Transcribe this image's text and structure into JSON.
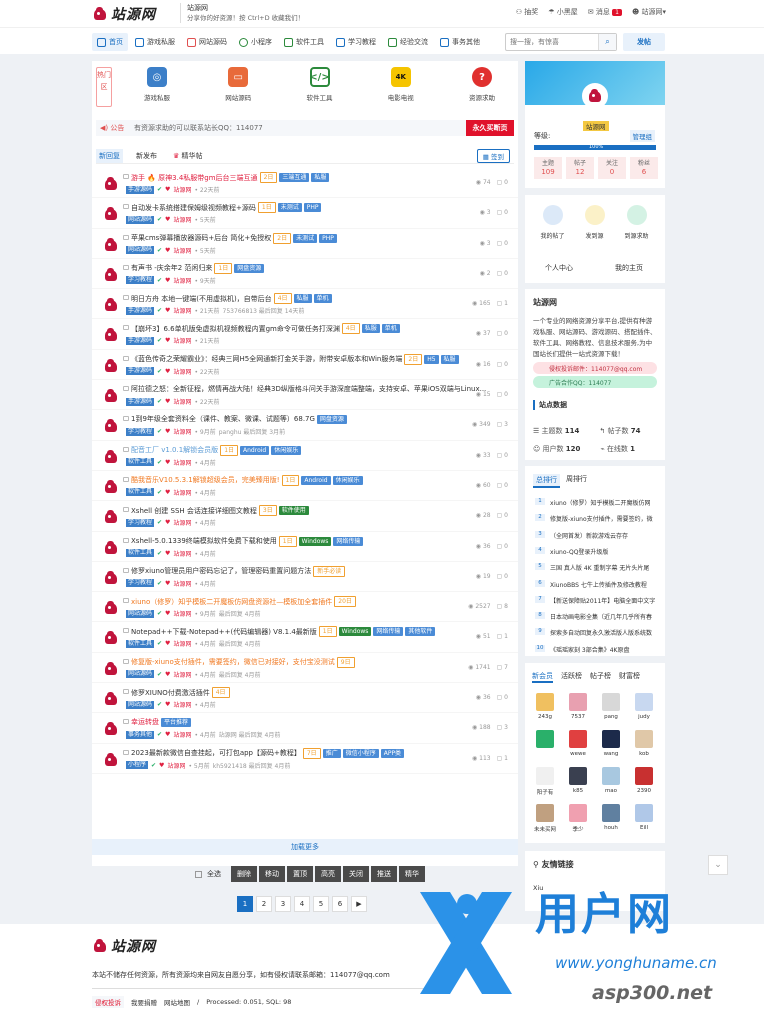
{
  "header": {
    "site_name": "站源网",
    "slogan_title": "站源网",
    "slogan_sub": "分享你的好资源！按 Ctrl+D 收藏我们！",
    "links": [
      "抽奖",
      "小黑屋",
      "消息",
      "站源网"
    ],
    "msg_count": "1"
  },
  "nav": {
    "items": [
      "首页",
      "游戏私服",
      "网站源码",
      "小程序",
      "软件工具",
      "学习教程",
      "经验交流",
      "事务其他"
    ],
    "search_placeholder": "搜一搜，有惊喜",
    "post": "发帖"
  },
  "hot": "热门区",
  "categories": [
    "游戏私服",
    "网站源码",
    "软件工具",
    "电影电视",
    "资源求助"
  ],
  "notice": {
    "label": "公告",
    "text": "有资源求助的可以联系站长QQ：114077",
    "button": "永久买断页"
  },
  "tabs": {
    "new_reply": "新回复",
    "new_post": "新发布",
    "digest": "精华帖",
    "signin": "签到"
  },
  "threads": [
    {
      "title": "游手 🔥 原神3.4私服带gm后台三端互通",
      "tags": [
        {
          "t": "2日",
          "c": "tg-orange"
        },
        {
          "t": "三端互通",
          "c": "tg-blue"
        },
        {
          "t": "私服",
          "c": "tg-blue"
        }
      ],
      "cat": "手游源码",
      "user": "站源网",
      "time": "22天前",
      "views": "74",
      "replies": "0",
      "tred": true
    },
    {
      "title": "自动发卡系统搭建保姆级视频教程+源码",
      "tags": [
        {
          "t": "1日",
          "c": "tg-orange"
        },
        {
          "t": "未测试",
          "c": "tg-blue"
        },
        {
          "t": "PHP",
          "c": "tg-blue"
        }
      ],
      "cat": "网站源码",
      "user": "站源网",
      "time": "5天前",
      "views": "3",
      "replies": "0"
    },
    {
      "title": "苹果cms弹幕播放器源码+后台 简化+免授权",
      "tags": [
        {
          "t": "2日",
          "c": "tg-orange"
        },
        {
          "t": "未测试",
          "c": "tg-blue"
        },
        {
          "t": "PHP",
          "c": "tg-blue"
        }
      ],
      "cat": "网站源码",
      "user": "站源网",
      "time": "5天前",
      "views": "3",
      "replies": "0"
    },
    {
      "title": "有声书 -庆余年2 范闲归来",
      "tags": [
        {
          "t": "1日",
          "c": "tg-orange"
        },
        {
          "t": "网盘资源",
          "c": "tg-blue"
        }
      ],
      "cat": "学习教程",
      "user": "站源网",
      "time": "9天前",
      "views": "2",
      "replies": "0"
    },
    {
      "title": "明日方舟 本地一键端(不用虚拟机)，自带后台",
      "tags": [
        {
          "t": "4日",
          "c": "tg-orange"
        },
        {
          "t": "私服",
          "c": "tg-blue"
        },
        {
          "t": "单机",
          "c": "tg-blue"
        }
      ],
      "cat": "手游源码",
      "user": "站源网",
      "time": "21天前",
      "extra": "753766813 最后回复 14天前",
      "views": "165",
      "replies": "1"
    },
    {
      "title": "【崩坏3】6.6单机版免虚拟机视频教程内置gm命令可做任务打深渊",
      "tags": [
        {
          "t": "4日",
          "c": "tg-orange"
        },
        {
          "t": "私服",
          "c": "tg-blue"
        },
        {
          "t": "单机",
          "c": "tg-blue"
        }
      ],
      "cat": "手游源码",
      "user": "站源网",
      "time": "21天前",
      "views": "37",
      "replies": "0"
    },
    {
      "title": "《蓝色传奇之荣耀霸业》：经典三网H5全网通新打金关手游，附带安卓版本和Win服务端",
      "tags": [
        {
          "t": "2日",
          "c": "tg-orange"
        },
        {
          "t": "H5",
          "c": "tg-blue"
        },
        {
          "t": "私服",
          "c": "tg-blue"
        }
      ],
      "cat": "手游源码",
      "user": "站源网",
      "time": "22天前",
      "views": "16",
      "replies": "0"
    },
    {
      "title": "阿拉德之怒：全新征程，燃情再战大陆！经典3D纵版格斗问关手游深度端整端，支持安卓、苹果iOS双端与Linux...",
      "tags": [],
      "cat": "手游源码",
      "user": "站源网",
      "time": "22天前",
      "views": "15",
      "replies": "0"
    },
    {
      "title": "1到9年级全套资料全（课件、教案、微课、试题等）68.7G",
      "tags": [
        {
          "t": "网盘资源",
          "c": "tg-blue"
        }
      ],
      "cat": "学习教程",
      "user": "站源网",
      "time": "9月前",
      "extra": "panghu 最后回复 3月前",
      "views": "349",
      "replies": "3"
    },
    {
      "title": "配音工厂 v1.0.1解锁会员版",
      "tags": [
        {
          "t": "1日",
          "c": "tg-orange"
        },
        {
          "t": "Android",
          "c": "tg-blue"
        },
        {
          "t": "休闲娱乐",
          "c": "tg-blue"
        }
      ],
      "cat": "软件工具",
      "user": "站源网",
      "time": "4月前",
      "views": "33",
      "replies": "0",
      "tblue": true
    },
    {
      "title": "酷我音乐V10.5.3.1解锁超级会员，完美臻用版!",
      "tags": [
        {
          "t": "1日",
          "c": "tg-orange"
        },
        {
          "t": "Android",
          "c": "tg-blue"
        },
        {
          "t": "休闲娱乐",
          "c": "tg-blue"
        }
      ],
      "cat": "软件工具",
      "user": "站源网",
      "time": "4月前",
      "views": "60",
      "replies": "0",
      "torange": true
    },
    {
      "title": "Xshell 创建 SSH 会话连接详细图文教程",
      "tags": [
        {
          "t": "3日",
          "c": "tg-orange"
        },
        {
          "t": "软件使用",
          "c": "tg-green"
        }
      ],
      "cat": "学习教程",
      "user": "站源网",
      "time": "4月前",
      "views": "28",
      "replies": "0"
    },
    {
      "title": "Xshell-5.0.1339终端模拟软件免费下载和使用",
      "tags": [
        {
          "t": "1日",
          "c": "tg-orange"
        },
        {
          "t": "Windows",
          "c": "tg-green"
        },
        {
          "t": "网络传输",
          "c": "tg-blue"
        }
      ],
      "cat": "软件工具",
      "user": "站源网",
      "time": "4月前",
      "views": "36",
      "replies": "0"
    },
    {
      "title": "修罗xiuno管理员用户密码忘记了，管理密码重置问题方法",
      "tags": [
        {
          "t": "新手必读",
          "c": "tg-orange"
        }
      ],
      "cat": "学习教程",
      "user": "站源网",
      "time": "4月前",
      "views": "19",
      "replies": "0"
    },
    {
      "title": "xiuno（修罗）知乎模板二开魔板仿网盘资源社—模板加全套插件",
      "tags": [
        {
          "t": "20日",
          "c": "tg-orange"
        }
      ],
      "cat": "网站源码",
      "user": "站源网",
      "time": "9月前",
      "extra": "最后回复 4月前",
      "views": "2527",
      "replies": "8",
      "torange": true
    },
    {
      "title": "Notepad++下载-Notepad++(代码编辑器) V8.1.4最新版",
      "tags": [
        {
          "t": "1日",
          "c": "tg-orange"
        },
        {
          "t": "Windows",
          "c": "tg-green"
        },
        {
          "t": "网络传输",
          "c": "tg-blue"
        },
        {
          "t": "其他软件",
          "c": "tg-blue"
        }
      ],
      "cat": "软件工具",
      "user": "站源网",
      "time": "4月前",
      "extra": "最后回复 4月前",
      "views": "51",
      "replies": "1"
    },
    {
      "title": "修复版-xiuno支付插件，需要签约，微信已对接好，支付宝没测试",
      "tags": [
        {
          "t": "9日",
          "c": "tg-orange"
        }
      ],
      "cat": "网站源码",
      "user": "站源网",
      "time": "4月前",
      "extra": "最后回复 4月前",
      "views": "1741",
      "replies": "7",
      "torange": true
    },
    {
      "title": "修罗XIUNO付费激活插件",
      "tags": [
        {
          "t": "4日",
          "c": "tg-orange"
        }
      ],
      "cat": "网站源码",
      "user": "站源网",
      "time": "4月前",
      "views": "36",
      "replies": "0"
    },
    {
      "title": "幸运转盘",
      "tags": [
        {
          "t": "平台推荐",
          "c": "tg-blue"
        }
      ],
      "cat": "事务其他",
      "user": "站源网",
      "time": "4月前",
      "extra": "站源网 最后回复 4月前",
      "views": "188",
      "replies": "3",
      "tred": true
    },
    {
      "title": "2023最新款微信自查挂起，可打包app【源码+教程】",
      "tags": [
        {
          "t": "7日",
          "c": "tg-orange"
        },
        {
          "t": "推广",
          "c": "tg-blue"
        },
        {
          "t": "微信小程序",
          "c": "tg-blue"
        },
        {
          "t": "APP类",
          "c": "tg-blue"
        }
      ],
      "cat": "小程序",
      "user": "站源网",
      "time": "5月前",
      "extra": "kh5921418 最后回复 4月前",
      "views": "113",
      "replies": "1"
    }
  ],
  "load_more": "加载更多",
  "actions": {
    "select_all": "全选",
    "buttons": [
      "删除",
      "移动",
      "置顶",
      "高亮",
      "关闭",
      "推送",
      "精华"
    ]
  },
  "pager": [
    "1",
    "2",
    "3",
    "4",
    "5",
    "6",
    "▶"
  ],
  "user_card": {
    "name": "站源网",
    "level_label": "等级:",
    "role": "管理组",
    "progress_label": "100%",
    "progress": 1.0,
    "stats": [
      {
        "l": "主题",
        "v": "109"
      },
      {
        "l": "帖子",
        "v": "12"
      },
      {
        "l": "关注",
        "v": "0"
      },
      {
        "l": "粉丝",
        "v": "6"
      }
    ]
  },
  "quick": {
    "items": [
      "我的帖了",
      "发到源",
      "到源求助"
    ],
    "center": "个人中心",
    "home": "我的主页"
  },
  "about": {
    "title": "站源网",
    "desc": "一个专业的网络资源分享平台,提供有种游戏私服、网站源码、游戏源码、搭配插件、软件工具、网络教程、信息技术服务,为中国站长们提供一站式资源下载！",
    "email": "侵权投诉邮件：114077@qq.com",
    "qq": "广告合作QQ：114077",
    "stats_title": "站点数据",
    "topics_label": "主题数",
    "topics": "114",
    "posts_label": "帖子数",
    "posts": "74",
    "users_label": "用户数",
    "users": "120",
    "online_label": "在线数",
    "online": "1"
  },
  "ranking": {
    "tabs": [
      "总排行",
      "周排行"
    ],
    "items": [
      "xiuno（修罗）知乎模板二开魔板仿网",
      "修复版-xiuno支付插件，需要签约，微",
      "（全网首发）新款游戏云存存",
      "xiuno-QQ登录升级版",
      "三国 真人版 4K 重制字幕 无片头片尾",
      "XiunoBBS 七牛上传插件及修改教程",
      "【新送保障贴2011年】电脑全面中文字",
      "日本动画电影全集（近几年几乎所有春",
      "探索多自动回复永久激活版人版系统数",
      "《瑶瑶家刻 3部合集》4K原盘"
    ]
  },
  "members": {
    "tabs": [
      "新会员",
      "活跃榜",
      "帖子榜",
      "财富榜"
    ],
    "names": [
      "243g",
      "7537",
      "pang",
      "judy",
      "",
      "wewe",
      "wang",
      "kob",
      "阳子有",
      "k85",
      "mao",
      "2390",
      "未未买网",
      "季少",
      "houh",
      "Eill"
    ]
  },
  "friend_links": {
    "title": "友情链接",
    "first": "Xiu"
  },
  "footer": {
    "name": "站源网",
    "desc": "本站不储存任何资源，所有资源均来自网友自愿分享，如有侵权请联系邮箱：114077@qq.com",
    "links": [
      "侵权投诉",
      "我要捐赠",
      "网站地图",
      "/",
      "Processed: 0.051, SQL: 98"
    ]
  },
  "watermark": {
    "big": "用户网",
    "url": "www.yonghuname.cn",
    "url2": "asp300.net"
  }
}
